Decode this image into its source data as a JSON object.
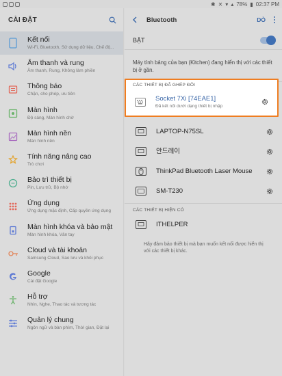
{
  "status_bar": {
    "battery": "78%",
    "time": "02:37 PM"
  },
  "settings": {
    "title": "CÀI ĐẶT",
    "items": [
      {
        "label": "Kết nối",
        "sub": "Wi-Fi, Bluetooth, Sử dụng dữ liệu, Chế độ...",
        "icon": "connections-icon",
        "selected": true
      },
      {
        "label": "Âm thanh và rung",
        "sub": "Âm thanh, Rung, Không làm phiền",
        "icon": "sound-icon"
      },
      {
        "label": "Thông báo",
        "sub": "Chặn, cho phép, ưu tiên",
        "icon": "notifications-icon"
      },
      {
        "label": "Màn hình",
        "sub": "Độ sáng, Màn hình chờ",
        "icon": "display-icon"
      },
      {
        "label": "Màn hình nền",
        "sub": "Màn hình nền",
        "icon": "wallpaper-icon"
      },
      {
        "label": "Tính năng nâng cao",
        "sub": "Trò chơi",
        "icon": "advanced-features-icon"
      },
      {
        "label": "Bảo trì thiết bị",
        "sub": "Pin, Lưu trữ, Bộ nhớ",
        "icon": "device-maintenance-icon"
      },
      {
        "label": "Ứng dụng",
        "sub": "Ứng dụng mặc định, Cấp quyền ứng dụng",
        "icon": "apps-icon"
      },
      {
        "label": "Màn hình khóa và bảo mật",
        "sub": "Màn hình khóa, Vân tay",
        "icon": "lock-screen-icon"
      },
      {
        "label": "Cloud và tài khoản",
        "sub": "Samsung Cloud, Sao lưu và khôi phục",
        "icon": "cloud-key-icon"
      },
      {
        "label": "Google",
        "sub": "Cài đặt Google",
        "icon": "google-icon"
      },
      {
        "label": "Hỗ trợ",
        "sub": "Nhìn, Nghe, Thao tác và tương tác",
        "icon": "accessibility-icon"
      },
      {
        "label": "Quản lý chung",
        "sub": "Ngôn ngữ và bàn phím, Thời gian, Đặt lại",
        "icon": "general-management-icon"
      }
    ]
  },
  "bluetooth": {
    "title": "Bluetooth",
    "scan_label": "DÒ",
    "toggle_label": "BẬT",
    "toggle_on": true,
    "visible_text": "Máy tính bảng của bạn (Kitchen) đang hiển thị với các thiết bị ở gần.",
    "paired_header": "CÁC THIẾT BỊ ĐÃ GHÉP ĐÔI",
    "paired": [
      {
        "name": "Socket 7Xi [74EAE1]",
        "status": "Đã kết nối dưới dạng thiết bị nhập",
        "icon": "keyboard-icon"
      },
      {
        "name": "LAPTOP-N75SL",
        "status": "",
        "icon": "laptop-icon"
      },
      {
        "name": "안드레이",
        "status": "",
        "icon": "laptop-icon"
      },
      {
        "name": "ThinkPad Bluetooth Laser Mouse",
        "status": "",
        "icon": "mouse-icon"
      },
      {
        "name": "SM-T230",
        "status": "",
        "icon": "tablet-icon"
      }
    ],
    "available_header": "CÁC THIẾT BỊ HIỆN CÓ",
    "available": [
      {
        "name": "ITHELPER",
        "icon": "laptop-icon"
      }
    ],
    "hint": "Hãy đảm bảo thiết bị mà bạn muốn kết nối được hiển thị với các thiết bị khác."
  },
  "colors": {
    "accent": "#3a67a8",
    "highlight": "#ef7d21",
    "background": "#d9d9d9"
  }
}
